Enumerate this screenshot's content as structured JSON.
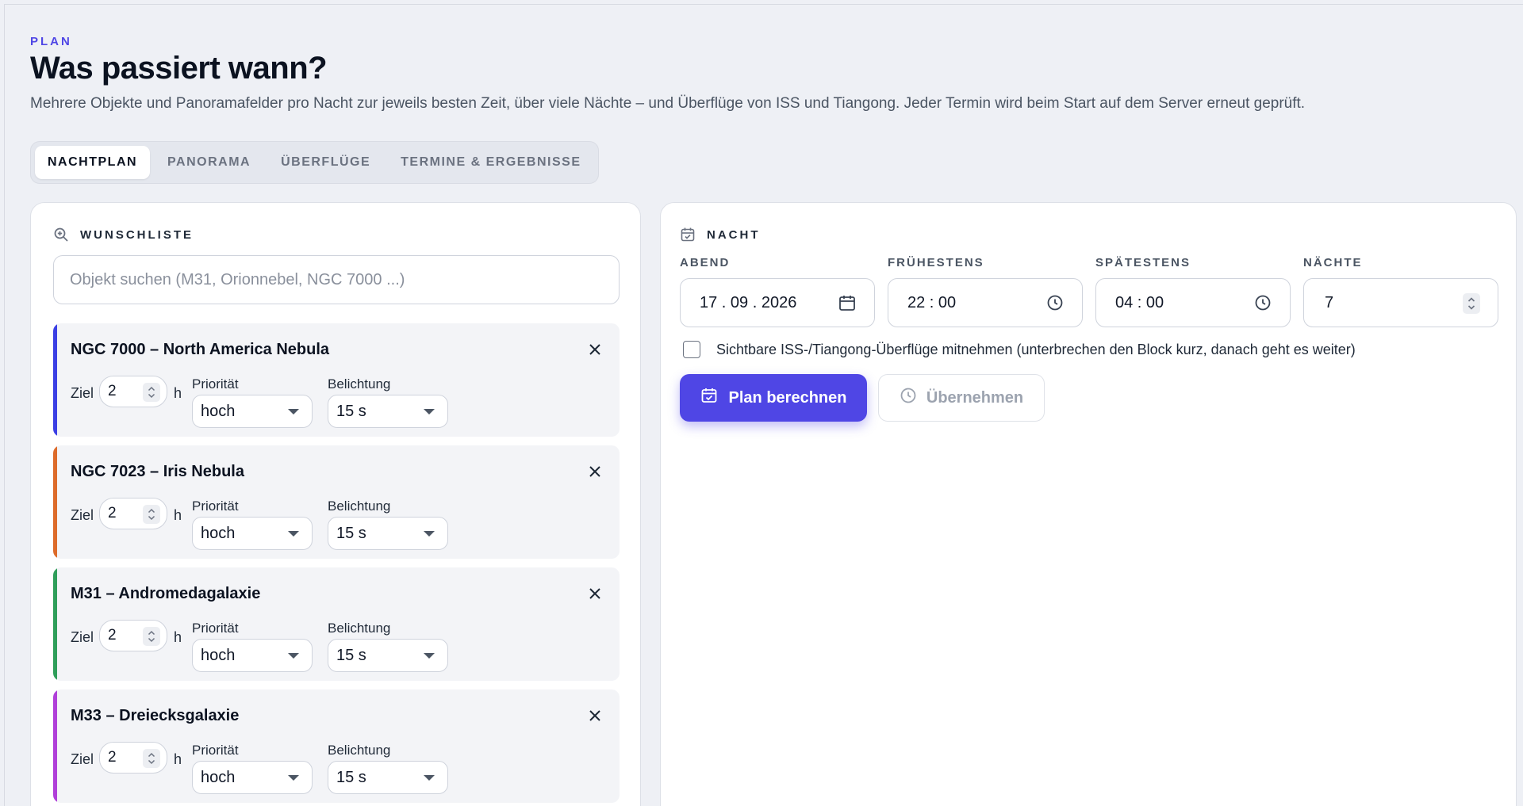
{
  "header": {
    "eyebrow": "PLAN",
    "title": "Was passiert wann?",
    "subtitle": "Mehrere Objekte und Panoramafelder pro Nacht zur jeweils besten Zeit, über viele Nächte – und Überflüge von ISS und Tiangong. Jeder Termin wird beim Start auf dem Server erneut geprüft."
  },
  "tabs": [
    {
      "label": "NACHTPLAN",
      "active": true
    },
    {
      "label": "PANORAMA",
      "active": false
    },
    {
      "label": "ÜBERFLÜGE",
      "active": false
    },
    {
      "label": "TERMINE & ERGEBNISSE",
      "active": false
    }
  ],
  "wishlist": {
    "heading": "WUNSCHLISTE",
    "icon": "zoom-in-icon",
    "search_placeholder": "Objekt suchen (M31, Orionnebel, NGC 7000 ...)",
    "search_value": "",
    "labels": {
      "ziel": "Ziel",
      "unit": "h",
      "priority": "Priorität",
      "exposure": "Belichtung"
    },
    "items": [
      {
        "name": "NGC 7000 – North America Nebula",
        "color": "#3b3fe4",
        "ziel": "2",
        "priority": "hoch",
        "exposure": "15 s"
      },
      {
        "name": "NGC 7023 – Iris Nebula",
        "color": "#dd6b2a",
        "ziel": "2",
        "priority": "hoch",
        "exposure": "15 s"
      },
      {
        "name": "M31 – Andromedagalaxie",
        "color": "#2f9e5a",
        "ziel": "2",
        "priority": "hoch",
        "exposure": "15 s"
      },
      {
        "name": "M33 – Dreiecksgalaxie",
        "color": "#b03fd9",
        "ziel": "2",
        "priority": "hoch",
        "exposure": "15 s"
      }
    ]
  },
  "night": {
    "heading": "NACHT",
    "icon": "calendar-check-icon",
    "fields": {
      "abend": {
        "label": "ABEND",
        "value": "17 . 09 . 2026",
        "icon": "calendar-icon"
      },
      "fruehestens": {
        "label": "FRÜHESTENS",
        "value": "22 : 00",
        "icon": "clock-icon"
      },
      "spaetestens": {
        "label": "SPÄTESTENS",
        "value": "04 : 00",
        "icon": "clock-icon"
      },
      "naechte": {
        "label": "NÄCHTE",
        "value": "7"
      }
    },
    "checkbox_label": "Sichtbare ISS-/Tiangong-Überflüge mitnehmen (unterbrechen den Block kurz, danach geht es weiter)",
    "checkbox_checked": false,
    "primary_button": "Plan berechnen",
    "secondary_button": "Übernehmen"
  },
  "colors": {
    "accent": "#4f46e5",
    "background": "#eef0f5",
    "card": "#ffffff"
  }
}
